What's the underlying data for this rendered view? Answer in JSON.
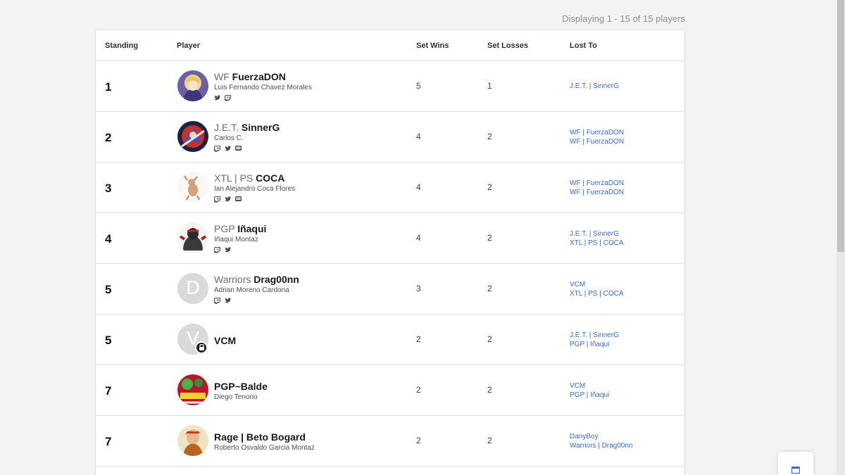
{
  "pagination": {
    "text": "Displaying 1 - 15 of 15 players"
  },
  "table": {
    "headers": {
      "standing": "Standing",
      "player": "Player",
      "set_wins": "Set Wins",
      "set_losses": "Set Losses",
      "lost_to": "Lost To"
    },
    "rows": [
      {
        "standing": "1",
        "prefix": "WF",
        "tag": "FuerzaDON",
        "real_name": "Luis Fernando Chavez Morales",
        "socials": [
          "twitter-icon",
          "twitch-icon"
        ],
        "set_wins": "5",
        "set_losses": "1",
        "lost_to": [
          "J.E.T. | SinnerG"
        ]
      },
      {
        "standing": "2",
        "prefix": "J.E.T.",
        "tag": "SinnerG",
        "real_name": "Carlos C.",
        "socials": [
          "twitch-icon",
          "twitter-icon",
          "discord-icon"
        ],
        "set_wins": "4",
        "set_losses": "2",
        "lost_to": [
          "WF | FuerzaDON",
          "WF | FuerzaDON"
        ]
      },
      {
        "standing": "3",
        "prefix": "XTL | PS",
        "tag": "COCA",
        "real_name": "Ian Alejandro Coca Flores",
        "socials": [
          "twitch-icon",
          "twitter-icon",
          "discord-icon"
        ],
        "set_wins": "4",
        "set_losses": "2",
        "lost_to": [
          "WF | FuerzaDON",
          "WF | FuerzaDON"
        ]
      },
      {
        "standing": "4",
        "prefix": "PGP",
        "tag": "Iñaqui",
        "real_name": "Iñaqui Montaz",
        "socials": [
          "twitch-icon",
          "twitter-icon"
        ],
        "set_wins": "4",
        "set_losses": "2",
        "lost_to": [
          "J.E.T. | SinnerG",
          "XTL | PS | COCA"
        ]
      },
      {
        "standing": "5",
        "prefix": "Warriors",
        "tag": "Drag00nn",
        "real_name": "Adrian Moreno Cardona",
        "avatar_letter": "D",
        "socials": [
          "twitch-icon",
          "twitter-icon"
        ],
        "set_wins": "3",
        "set_losses": "2",
        "lost_to": [
          "VCM",
          "XTL | PS | COCA"
        ]
      },
      {
        "standing": "5",
        "prefix": "",
        "tag": "VCM",
        "real_name": "",
        "avatar_letter": "V",
        "socials": [],
        "set_wins": "2",
        "set_losses": "2",
        "lost_to": [
          "J.E.T. | SinnerG",
          "PGP | Iñaqui"
        ]
      },
      {
        "standing": "7",
        "prefix": "",
        "tag": "PGP~Balde",
        "real_name": "Diego Tenorio",
        "socials": [],
        "set_wins": "2",
        "set_losses": "2",
        "lost_to": [
          "VCM",
          "PGP | Iñaqui"
        ]
      },
      {
        "standing": "7",
        "prefix": "",
        "tag": "Rage | Beto Bogard",
        "real_name": "Roberto Osvaldo Garcia Montaz",
        "socials": [],
        "set_wins": "2",
        "set_losses": "2",
        "lost_to": [
          "DanyBoy",
          "Warriors | Drag00nn"
        ]
      }
    ]
  },
  "colors": {
    "link": "#3b6bc9",
    "prefix": "#686e74",
    "border": "#e3e3e3",
    "page_bg": "#f3f3f3"
  }
}
